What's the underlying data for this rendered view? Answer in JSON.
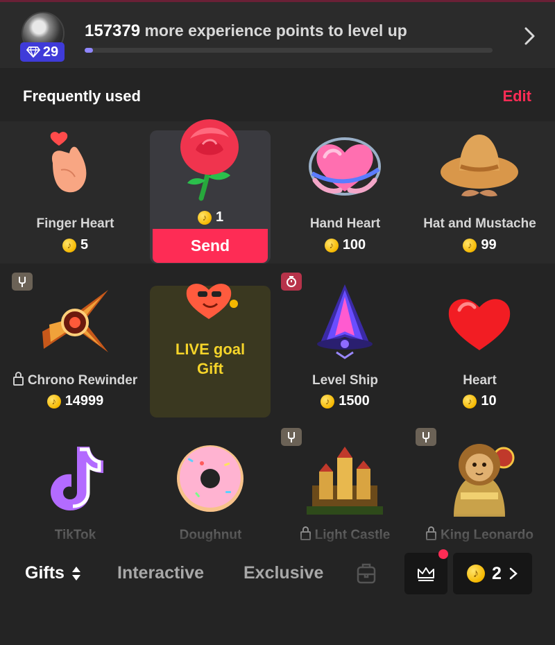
{
  "header": {
    "level": "29",
    "xp_points": "157379",
    "xp_suffix": " more experience points to level up",
    "xp_progress": 0.02
  },
  "frequently_used": {
    "title": "Frequently used",
    "edit_label": "Edit",
    "gifts": [
      {
        "name": "Finger Heart",
        "price": "5",
        "icon": "finger-heart-icon"
      },
      {
        "name": "",
        "price": "1",
        "icon": "rose-icon",
        "selected": true
      },
      {
        "name": "Hand Heart",
        "price": "100",
        "icon": "hand-heart-icon"
      },
      {
        "name": "Hat and Mustache",
        "price": "99",
        "icon": "hat-mustache-icon"
      }
    ],
    "send_label": "Send"
  },
  "gift_grid": {
    "row1": [
      {
        "name": "Chrono Rewinder",
        "price": "14999",
        "locked": true,
        "icon": "chrono-rewinder-icon"
      },
      {
        "live_goal_label_1": "LIVE goal",
        "live_goal_label_2": "Gift",
        "icon": "live-goal-heart-icon"
      },
      {
        "name": "Level Ship",
        "price": "1500",
        "icon": "level-ship-icon"
      },
      {
        "name": "Heart",
        "price": "10",
        "icon": "heart-icon"
      }
    ],
    "row2": [
      {
        "name": "TikTok",
        "icon": "tiktok-logo-icon"
      },
      {
        "name": "Doughnut",
        "icon": "doughnut-icon"
      },
      {
        "name": "Light Castle",
        "locked": true,
        "icon": "light-castle-icon"
      },
      {
        "name": "King Leonardo",
        "locked": true,
        "icon": "king-leonardo-icon"
      }
    ]
  },
  "bottom_nav": {
    "tabs": [
      "Gifts",
      "Interactive",
      "Exclusive"
    ],
    "active_tab": "Gifts",
    "coin_balance": "2"
  },
  "colors": {
    "accent": "#fe2c55",
    "background": "#242424",
    "level_badge": "#3f3bd9",
    "live_goal_text": "#f5d42a"
  }
}
